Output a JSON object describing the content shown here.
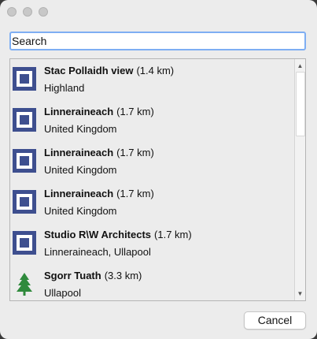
{
  "search": {
    "value": "Search"
  },
  "results": [
    {
      "name": "Stac Pollaidh view",
      "distance": "(1.4 km)",
      "location": "Highland",
      "icon": "viewpoint-icon"
    },
    {
      "name": "Linneraineach",
      "distance": "(1.7 km)",
      "location": "United Kingdom",
      "icon": "viewpoint-icon"
    },
    {
      "name": "Linneraineach",
      "distance": "(1.7 km)",
      "location": "United Kingdom",
      "icon": "viewpoint-icon"
    },
    {
      "name": "Linneraineach",
      "distance": "(1.7 km)",
      "location": "United Kingdom",
      "icon": "viewpoint-icon"
    },
    {
      "name": "Studio R\\W Architects",
      "distance": "(1.7 km)",
      "location": "Linneraineach, Ullapool",
      "icon": "viewpoint-icon"
    },
    {
      "name": "Sgorr Tuath",
      "distance": "(3.3 km)",
      "location": "Ullapool",
      "icon": "tree-icon"
    }
  ],
  "buttons": {
    "cancel": "Cancel"
  },
  "colors": {
    "viewpoint_icon": "#3e4f8f",
    "tree_icon": "#2f8a3c",
    "search_focus": "#7eaef3"
  }
}
